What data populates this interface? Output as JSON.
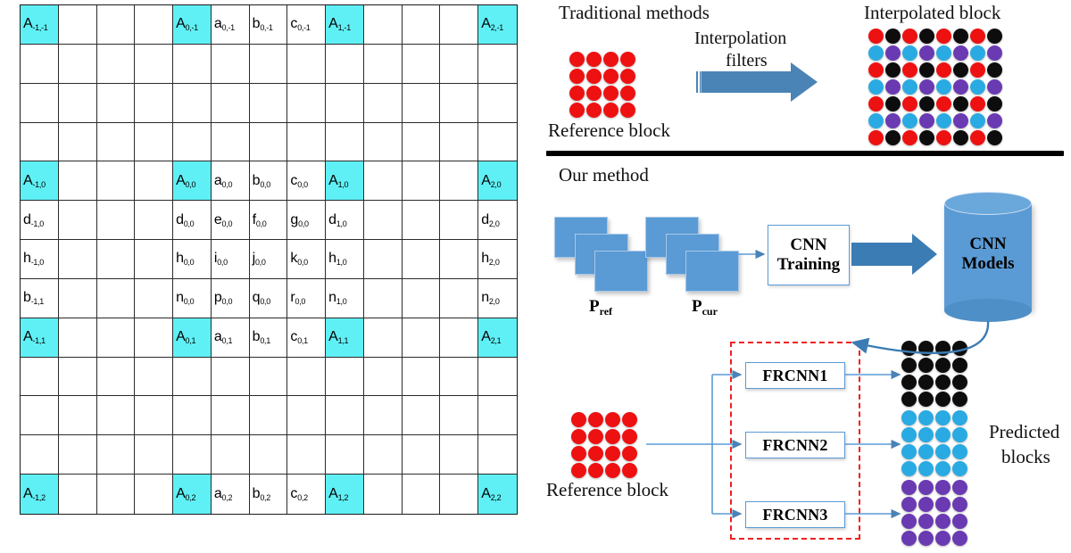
{
  "left_grid": {
    "name": "fractional-pixel-position-grid",
    "rows": 13,
    "cols": 13,
    "highlight_color": "#5ff0f5",
    "cells": [
      [
        {
          "t": "A",
          "s": "-1,-1",
          "h": true
        },
        {},
        {},
        {},
        {
          "t": "A",
          "s": "0,-1",
          "h": true
        },
        {
          "t": "a",
          "s": "0,-1"
        },
        {
          "t": "b",
          "s": "0,-1"
        },
        {
          "t": "c",
          "s": "0,-1"
        },
        {
          "t": "A",
          "s": "1,-1",
          "h": true
        },
        {},
        {},
        {},
        {
          "t": "A",
          "s": "2,-1",
          "h": true
        }
      ],
      [
        {},
        {},
        {},
        {},
        {},
        {},
        {},
        {},
        {},
        {},
        {},
        {},
        {}
      ],
      [
        {},
        {},
        {},
        {},
        {},
        {},
        {},
        {},
        {},
        {},
        {},
        {},
        {}
      ],
      [
        {},
        {},
        {},
        {},
        {},
        {},
        {},
        {},
        {},
        {},
        {},
        {},
        {}
      ],
      [
        {
          "t": "A",
          "s": "-1,0",
          "h": true
        },
        {},
        {},
        {},
        {
          "t": "A",
          "s": "0,0",
          "h": true
        },
        {
          "t": "a",
          "s": "0,0"
        },
        {
          "t": "b",
          "s": "0,0"
        },
        {
          "t": "c",
          "s": "0,0"
        },
        {
          "t": "A",
          "s": "1,0",
          "h": true
        },
        {},
        {},
        {},
        {
          "t": "A",
          "s": "2,0",
          "h": true
        }
      ],
      [
        {
          "t": "d",
          "s": "-1,0"
        },
        {},
        {},
        {},
        {
          "t": "d",
          "s": "0,0"
        },
        {
          "t": "e",
          "s": "0,0"
        },
        {
          "t": "f",
          "s": "0,0"
        },
        {
          "t": "g",
          "s": "0,0"
        },
        {
          "t": "d",
          "s": "1,0"
        },
        {},
        {},
        {},
        {
          "t": "d",
          "s": "2,0"
        }
      ],
      [
        {
          "t": "h",
          "s": "-1,0"
        },
        {},
        {},
        {},
        {
          "t": "h",
          "s": "0,0"
        },
        {
          "t": "i",
          "s": "0,0"
        },
        {
          "t": "j",
          "s": "0,0"
        },
        {
          "t": "k",
          "s": "0,0"
        },
        {
          "t": "h",
          "s": "1,0"
        },
        {},
        {},
        {},
        {
          "t": "h",
          "s": "2,0"
        }
      ],
      [
        {
          "t": "b",
          "s": "-1,1"
        },
        {},
        {},
        {},
        {
          "t": "n",
          "s": "0,0"
        },
        {
          "t": "p",
          "s": "0,0"
        },
        {
          "t": "q",
          "s": "0,0"
        },
        {
          "t": "r",
          "s": "0,0"
        },
        {
          "t": "n",
          "s": "1,0"
        },
        {},
        {},
        {},
        {
          "t": "n",
          "s": "2,0"
        }
      ],
      [
        {
          "t": "A",
          "s": "-1,1",
          "h": true
        },
        {},
        {},
        {},
        {
          "t": "A",
          "s": "0,1",
          "h": true
        },
        {
          "t": "a",
          "s": "0,1"
        },
        {
          "t": "b",
          "s": "0,1"
        },
        {
          "t": "c",
          "s": "0,1"
        },
        {
          "t": "A",
          "s": "1,1",
          "h": true
        },
        {},
        {},
        {},
        {
          "t": "A",
          "s": "2,1",
          "h": true
        }
      ],
      [
        {},
        {},
        {},
        {},
        {},
        {},
        {},
        {},
        {},
        {},
        {},
        {},
        {}
      ],
      [
        {},
        {},
        {},
        {},
        {},
        {},
        {},
        {},
        {},
        {},
        {},
        {},
        {}
      ],
      [
        {},
        {},
        {},
        {},
        {},
        {},
        {},
        {},
        {},
        {},
        {},
        {},
        {}
      ],
      [
        {
          "t": "A",
          "s": "-1,2",
          "h": true
        },
        {},
        {},
        {},
        {
          "t": "A",
          "s": "0,2",
          "h": true
        },
        {
          "t": "a",
          "s": "0,2"
        },
        {
          "t": "b",
          "s": "0,2"
        },
        {
          "t": "c",
          "s": "0,2"
        },
        {
          "t": "A",
          "s": "1,2",
          "h": true
        },
        {},
        {},
        {},
        {
          "t": "A",
          "s": "2,2",
          "h": true
        }
      ]
    ]
  },
  "traditional": {
    "title": "Traditional methods",
    "arrow_label_line1": "Interpolation",
    "arrow_label_line2": "filters",
    "reference_label": "Reference block",
    "interpolated_label": "Interpolated block",
    "reference_block": {
      "cols": 4,
      "rows": 4,
      "color": "#ee1111"
    },
    "interpolated_block": {
      "cols": 8,
      "rows": 7,
      "row_patterns": [
        [
          "#ee1111",
          "#0d0d0d"
        ],
        [
          "#2aaae2",
          "#6a3ab2"
        ],
        [
          "#ee1111",
          "#0d0d0d"
        ],
        [
          "#2aaae2",
          "#6a3ab2"
        ],
        [
          "#ee1111",
          "#0d0d0d"
        ],
        [
          "#2aaae2",
          "#6a3ab2"
        ],
        [
          "#ee1111",
          "#0d0d0d"
        ]
      ]
    }
  },
  "our_method": {
    "title": "Our method",
    "pref_label": "P",
    "pref_sub": "ref",
    "pcur_label": "P",
    "pcur_sub": "cur",
    "cnn_training_line1": "CNN",
    "cnn_training_line2": "Training",
    "cnn_models_line1": "CNN",
    "cnn_models_line2": "Models",
    "reference_label": "Reference block",
    "predicted_line1": "Predicted",
    "predicted_line2": "blocks",
    "frcnn": [
      "FRCNN1",
      "FRCNN2",
      "FRCNN3"
    ],
    "reference_block": {
      "cols": 4,
      "rows": 4,
      "color": "#ee1111"
    },
    "predicted_blocks": [
      {
        "cols": 4,
        "rows": 4,
        "color": "#0d0d0d"
      },
      {
        "cols": 4,
        "rows": 4,
        "color": "#2aaae2"
      },
      {
        "cols": 4,
        "rows": 4,
        "color": "#6a3ab2"
      }
    ]
  },
  "colors": {
    "accent_blue": "#5b9bd5",
    "arrow_blue": "#4a83b6",
    "dash_red": "#ef2020",
    "highlight_cyan": "#5ff0f5",
    "divider_black": "#000000"
  }
}
